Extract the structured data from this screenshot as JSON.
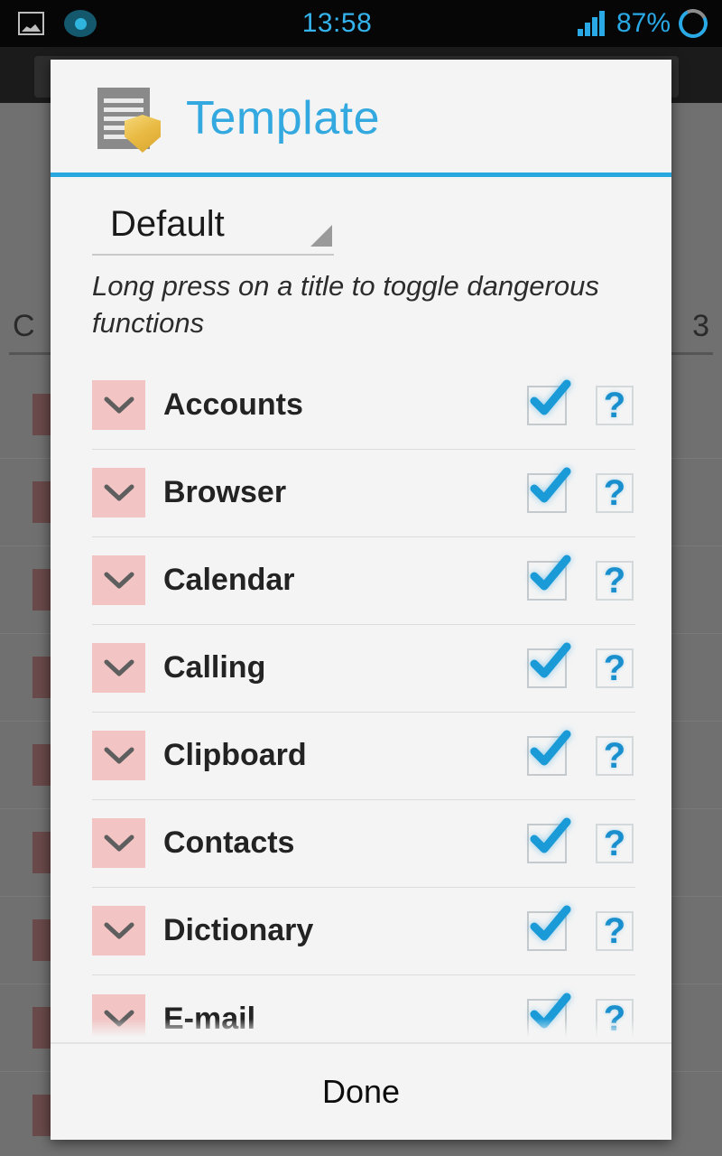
{
  "status_bar": {
    "time": "13:58",
    "battery_percent": "87%",
    "left_icons": [
      "screenshot-image-icon",
      "recording-dot-icon"
    ],
    "right_icons": [
      "signal-bars-icon",
      "battery-ring-icon"
    ],
    "accent_color": "#29a9e6",
    "background_color": "#060606"
  },
  "background_app": {
    "tab_left_label": "C",
    "tab_right_label": "3"
  },
  "dialog": {
    "title": "Template",
    "title_color": "#33a9e0",
    "header_icon": "document-shield-icon",
    "divider_color": "#29a8e0",
    "spinner": {
      "label": "Default",
      "options": [
        "Default"
      ]
    },
    "hint": "Long press on a title to toggle dangerous functions",
    "rows": [
      {
        "label": "Accounts",
        "checked": true,
        "expand_icon": "chevron-down-icon",
        "help_icon": "question-mark-icon"
      },
      {
        "label": "Browser",
        "checked": true,
        "expand_icon": "chevron-down-icon",
        "help_icon": "question-mark-icon"
      },
      {
        "label": "Calendar",
        "checked": true,
        "expand_icon": "chevron-down-icon",
        "help_icon": "question-mark-icon"
      },
      {
        "label": "Calling",
        "checked": true,
        "expand_icon": "chevron-down-icon",
        "help_icon": "question-mark-icon"
      },
      {
        "label": "Clipboard",
        "checked": true,
        "expand_icon": "chevron-down-icon",
        "help_icon": "question-mark-icon"
      },
      {
        "label": "Contacts",
        "checked": true,
        "expand_icon": "chevron-down-icon",
        "help_icon": "question-mark-icon"
      },
      {
        "label": "Dictionary",
        "checked": true,
        "expand_icon": "chevron-down-icon",
        "help_icon": "question-mark-icon"
      },
      {
        "label": "E-mail",
        "checked": true,
        "expand_icon": "chevron-down-icon",
        "help_icon": "question-mark-icon"
      }
    ],
    "footer": {
      "done_label": "Done"
    },
    "row_accent_color": "#f2c4c4",
    "check_color": "#1a8fcd"
  }
}
